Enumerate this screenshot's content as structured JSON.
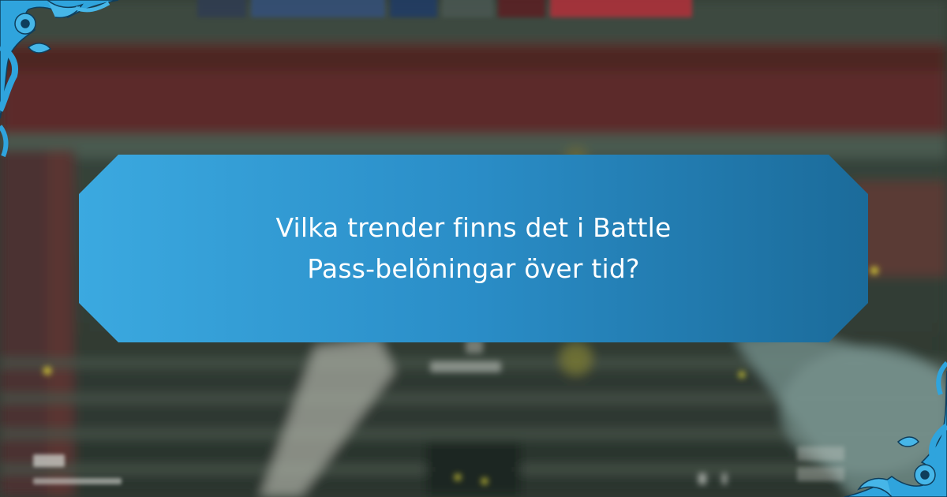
{
  "banner": {
    "title": "Vilka trender finns det i Battle Pass-belöningar över tid?",
    "gradient_start": "#3ba9e0",
    "gradient_end": "#1b6b9a",
    "text_color": "#ffffff"
  },
  "background": {
    "description_colors": [
      "#2e3a33",
      "#5a2a28",
      "#3f4a3e"
    ]
  },
  "ornaments": {
    "top_left": "floral-corner-icon",
    "bottom_right": "floral-corner-icon",
    "color": "#2fa4dd"
  }
}
